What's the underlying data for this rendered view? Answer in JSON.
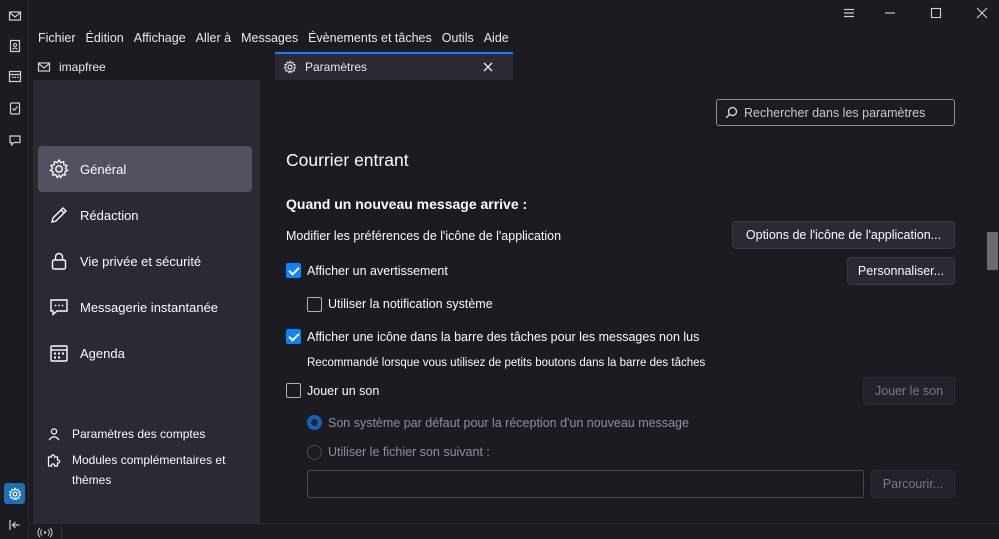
{
  "menu": [
    "Fichier",
    "Édition",
    "Affichage",
    "Aller à",
    "Messages",
    "Évènements et tâches",
    "Outils",
    "Aide"
  ],
  "tabs": {
    "mail": "imapfree",
    "settings": "Paramètres"
  },
  "nav": {
    "items": [
      {
        "label": "Général",
        "icon": "gear-icon"
      },
      {
        "label": "Rédaction",
        "icon": "pencil-icon"
      },
      {
        "label": "Vie privée et sécurité",
        "icon": "lock-icon"
      },
      {
        "label": "Messagerie instantanée",
        "icon": "chat-icon"
      },
      {
        "label": "Agenda",
        "icon": "calendar-icon"
      }
    ],
    "accounts": "Paramètres des comptes",
    "addons": "Modules complémentaires et",
    "addons_line2": "thèmes"
  },
  "search": {
    "placeholder": "Rechercher dans les paramètres"
  },
  "section": {
    "title": "Courrier entrant",
    "subtitle": "Quand un nouveau message arrive :",
    "app_icon_label": "Modifier les préférences de l'icône de l'application",
    "app_icon_button": "Options de l'icône de l'application...",
    "show_alert": "Afficher un avertissement",
    "customize_button": "Personnaliser...",
    "system_notification": "Utiliser la notification système",
    "taskbar_icon": "Afficher une icône dans la barre des tâches pour les messages non lus",
    "taskbar_hint": "Recommandé lorsque vous utilisez de petits boutons dans la barre des tâches",
    "play_sound": "Jouer un son",
    "play_sound_button": "Jouer le son",
    "default_sound": "Son système par défaut pour la réception d'un nouveau message",
    "custom_sound": "Utiliser le fichier son suivant :",
    "browse_button": "Parcourir..."
  },
  "state": {
    "show_alert": true,
    "system_notification": false,
    "taskbar_icon": true,
    "play_sound": false,
    "sound_choice": "default"
  },
  "colors": {
    "accent": "#0a84ff",
    "active_nav": "#52525e",
    "panel": "#2b2a33",
    "background": "#1c1b22"
  }
}
